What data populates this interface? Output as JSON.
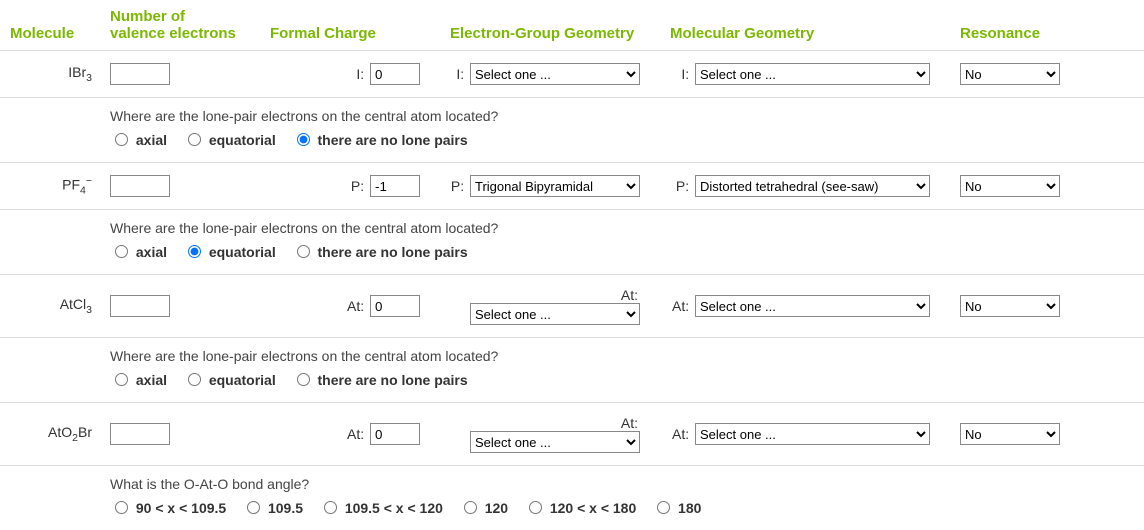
{
  "headers": {
    "molecule": "Molecule",
    "valence": "Number of\nvalence electrons",
    "formal": "Formal Charge",
    "egg": "Electron-Group Geometry",
    "mg": "Molecular Geometry",
    "res": "Resonance"
  },
  "select_placeholder": "Select one ...",
  "res_no": "No",
  "lonepair_question": "Where are the lone-pair electrons on the central atom located?",
  "lonepair_opts": {
    "axial": "axial",
    "equatorial": "equatorial",
    "none": "there are no lone pairs"
  },
  "bondangle_question": "What is the O-At-O bond angle?",
  "bondangle_opts": {
    "a": "90 < x < 109.5",
    "b": "109.5",
    "c": "109.5 < x < 120",
    "d": "120",
    "e": "120 < x < 180",
    "f": "180"
  },
  "rows": {
    "r1": {
      "atom": "I",
      "fc": "0",
      "egg_val": "Select one ...",
      "mg_val": "Select one ...",
      "res": "No"
    },
    "r2": {
      "atom": "P",
      "fc": "-1",
      "egg_val": "Trigonal Bipyramidal",
      "mg_val": "Distorted tetrahedral (see-saw)",
      "res": "No"
    },
    "r3": {
      "atom": "At",
      "fc": "0",
      "egg_val": "Select one ...",
      "mg_val": "Select one ...",
      "res": "No"
    },
    "r4": {
      "atom": "At",
      "fc": "0",
      "egg_val": "Select one ...",
      "mg_val": "Select one ...",
      "res": "No"
    }
  }
}
